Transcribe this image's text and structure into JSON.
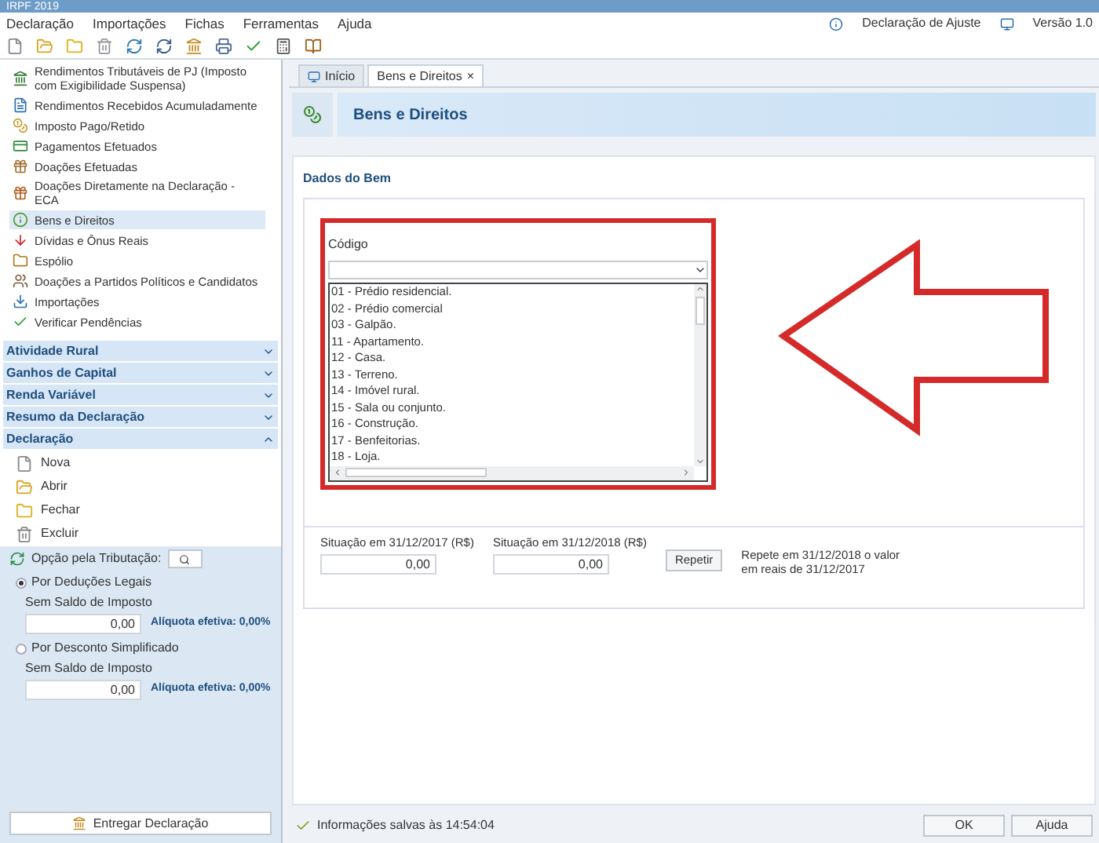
{
  "window": {
    "title": "IRPF 2019"
  },
  "menu": [
    "Declaração",
    "Importações",
    "Fichas",
    "Ferramentas",
    "Ajuda"
  ],
  "top_right": [
    "Declaração de Ajuste",
    "Versão 1.0"
  ],
  "sidebar": {
    "items": [
      {
        "label": "Rendimentos Tributáveis de PJ (Imposto com Exigibilidade Suspensa)",
        "selected": false
      },
      {
        "label": "Rendimentos Recebidos Acumuladamente",
        "selected": false
      },
      {
        "label": "Imposto Pago/Retido",
        "selected": false
      },
      {
        "label": "Pagamentos Efetuados",
        "selected": false
      },
      {
        "label": "Doações Efetuadas",
        "selected": false
      },
      {
        "label": "Doações Diretamente na Declaração - ECA",
        "selected": false
      },
      {
        "label": "Bens e Direitos",
        "selected": true
      },
      {
        "label": "Dívidas e Ônus Reais",
        "selected": false
      },
      {
        "label": "Espólio",
        "selected": false
      },
      {
        "label": "Doações a Partidos Políticos e Candidatos",
        "selected": false
      },
      {
        "label": "Importações",
        "selected": false
      },
      {
        "label": "Verificar Pendências",
        "selected": false
      }
    ],
    "sections": [
      {
        "label": "Atividade Rural",
        "expanded": false
      },
      {
        "label": "Ganhos de Capital",
        "expanded": false
      },
      {
        "label": "Renda Variável",
        "expanded": false
      },
      {
        "label": "Resumo da Declaração",
        "expanded": false
      },
      {
        "label": "Declaração",
        "expanded": true
      }
    ],
    "actions": [
      "Nova",
      "Abrir",
      "Fechar",
      "Excluir"
    ]
  },
  "tributacao": {
    "label": "Opção pela Tributação:",
    "options": [
      {
        "label": "Por Deduções Legais",
        "selected": true,
        "sublabel": "Sem Saldo de Imposto",
        "value": "0,00",
        "rate": "Alíquota efetiva: 0,00%"
      },
      {
        "label": "Por Desconto Simplificado",
        "selected": false,
        "sublabel": "Sem Saldo de Imposto",
        "value": "0,00",
        "rate": "Alíquota efetiva: 0,00%"
      }
    ],
    "button": "Entregar Declaração"
  },
  "tabs": [
    {
      "label": "Início",
      "selected": false
    },
    {
      "label": "Bens e Direitos",
      "selected": true,
      "close": "×"
    }
  ],
  "header": {
    "title": "Bens e Direitos"
  },
  "form": {
    "section": "Dados do Bem",
    "codigo_label": "Código",
    "options": [
      "01 - Prédio residencial.",
      "02 - Prédio comercial",
      "03 - Galpão.",
      "11 - Apartamento.",
      "12 - Casa.",
      "13 - Terreno.",
      "14 - Imóvel rural.",
      "15 - Sala ou conjunto.",
      "16 - Construção.",
      "17 - Benfeitorias.",
      "18 - Loja."
    ],
    "fields": [
      {
        "label": "Situação em 31/12/2017 (R$)",
        "value": "0,00"
      },
      {
        "label": "Situação em 31/12/2018 (R$)",
        "value": "0,00"
      }
    ],
    "repeat_button": "Repetir",
    "repeat_note": "Repete em 31/12/2018 o valor em reais de 31/12/2017"
  },
  "status_bar": {
    "text": "Informações salvas às 14:54:04",
    "buttons": [
      "OK",
      "Ajuda"
    ]
  }
}
